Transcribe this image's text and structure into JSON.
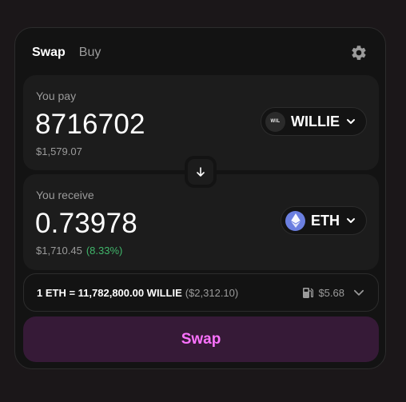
{
  "tabs": {
    "swap": "Swap",
    "buy": "Buy"
  },
  "pay": {
    "label": "You pay",
    "amount": "8716702",
    "fiat": "$1,579.07",
    "token": {
      "symbol": "WILLIE",
      "logo_text": "WIL"
    }
  },
  "receive": {
    "label": "You receive",
    "amount": "0.73978",
    "fiat": "$1,710.45",
    "delta": "(8.33%)",
    "token": {
      "symbol": "ETH"
    }
  },
  "rate": {
    "text": "1 ETH = 11,782,800.00 WILLIE",
    "usd": "($2,312.10)",
    "gas": "$5.68"
  },
  "swap_button": "Swap",
  "colors": {
    "accent": "#fc72ff",
    "accent_bg": "#361a37",
    "positive": "#40b66b",
    "eth": "#6b7fe0"
  },
  "icons": [
    "gear-icon",
    "arrow-down-icon",
    "chevron-down-icon",
    "gas-pump-icon",
    "eth-logo-icon",
    "willie-logo-icon"
  ]
}
